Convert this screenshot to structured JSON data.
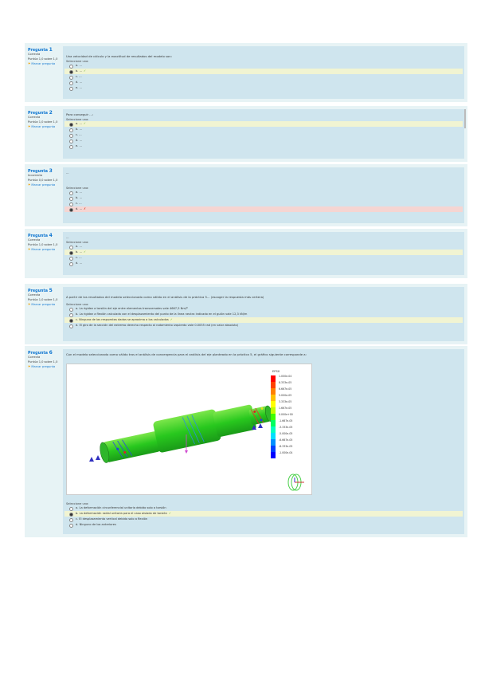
{
  "flag_label": "Marcar pregunta",
  "select_one": "Seleccione una:",
  "questions": [
    {
      "id": "1",
      "title_word": "Pregunta",
      "state": "Correcta",
      "score": "Puntúa 1,0 sobre 1,0",
      "text": "Una velocidad de cálculo y la exactitud de resultados del modelo son:",
      "options": [
        {
          "text": "a. ...",
          "status": "",
          "mark": ""
        },
        {
          "text": "b. ...",
          "status": "correct",
          "mark": "✓"
        },
        {
          "text": "c. ...",
          "status": "",
          "mark": ""
        },
        {
          "text": "d. ...",
          "status": "",
          "mark": ""
        },
        {
          "text": "e. ...",
          "status": "",
          "mark": ""
        }
      ]
    },
    {
      "id": "2",
      "title_word": "Pregunta",
      "state": "Correcta",
      "score": "Puntúa 1,0 sobre 1,0",
      "text": "Para conseguir ...:",
      "options": [
        {
          "text": "a. ...",
          "status": "correct",
          "mark": "✓"
        },
        {
          "text": "b. ...",
          "status": "",
          "mark": ""
        },
        {
          "text": "c. ...",
          "status": "",
          "mark": ""
        },
        {
          "text": "d. ...",
          "status": "",
          "mark": ""
        },
        {
          "text": "e. ...",
          "status": "",
          "mark": ""
        }
      ]
    },
    {
      "id": "3",
      "title_word": "Pregunta",
      "state": "Incorrecta",
      "score": "Puntúa 0,0 sobre 1,0",
      "text": "...",
      "options": [
        {
          "text": "a. ...",
          "status": "",
          "mark": ""
        },
        {
          "text": "b. ...",
          "status": "",
          "mark": ""
        },
        {
          "text": "c. ...",
          "status": "",
          "mark": ""
        },
        {
          "text": "d. ...",
          "status": "incorrect",
          "mark": "✗"
        }
      ]
    },
    {
      "id": "4",
      "title_word": "Pregunta",
      "state": "Correcta",
      "score": "Puntúa 1,0 sobre 1,0",
      "text": "...",
      "options": [
        {
          "text": "a. ...",
          "status": "",
          "mark": ""
        },
        {
          "text": "b. ...",
          "status": "correct",
          "mark": "✓"
        },
        {
          "text": "c. ...",
          "status": "",
          "mark": ""
        },
        {
          "text": "d. ...",
          "status": "",
          "mark": ""
        }
      ]
    },
    {
      "id": "5",
      "title_word": "Pregunta",
      "state": "Correcta",
      "score": "Puntúa 1,0 sobre 1,0",
      "text": "A partir de los resultados del modelo seleccionado como válido en el análisis de la práctica 5... (escoger la respuesta más certera)",
      "options": [
        {
          "text": "a. La rigidez a torsión del eje entre elementos transversales vale 4667,5 Nm/º",
          "status": "",
          "mark": ""
        },
        {
          "text": "b. La rigidez a flexión calculada con el desplazamiento del punto de la línea neutra indicado en el guión vale 12,3 kN/m",
          "status": "",
          "mark": ""
        },
        {
          "text": "c. Ninguna de las respuestas dadas se aproxima a los calculados",
          "status": "correct",
          "mark": "✓"
        },
        {
          "text": "d. El giro de la sección del extremo derecho respecto al rodamiento izquierdo vale 0.0055 rad (en valor absoluto)",
          "status": "",
          "mark": ""
        }
      ]
    },
    {
      "id": "6",
      "title_word": "Pregunta",
      "state": "Correcta",
      "score": "Puntúa 1,0 sobre 1,0",
      "text": "Con el modelo seleccionado como válido tras el análisis de convergencia para el análisis del eje planteado en la práctica 5, el gráfico siguiente corresponde a:",
      "figure": {
        "legend_title": "EPSX",
        "legend_values": [
          "1.000e-04",
          "8.333e-05",
          "6.667e-05",
          "5.000e-05",
          "3.333e-05",
          "1.667e-05",
          "0.000e+00",
          "-1.667e-05",
          "-3.333e-05",
          "-5.000e-05",
          "-6.667e-05",
          "-8.333e-05",
          "-1.000e-04"
        ],
        "legend_colors": [
          "#ff0000",
          "#ff4000",
          "#ff8000",
          "#ffc000",
          "#ffff00",
          "#c0ff00",
          "#40ff00",
          "#00ff60",
          "#00ffc0",
          "#00e0ff",
          "#0090ff",
          "#0040ff",
          "#0000ff"
        ]
      },
      "options": [
        {
          "text": "a. La deformación circunferencial unitaria debido solo a torsión",
          "status": "",
          "mark": ""
        },
        {
          "text": "b. La deformación radial unitaria para el caso aislado de torsión",
          "status": "correct",
          "mark": "✓"
        },
        {
          "text": "c. El desplazamiento vertical debido solo a flexión",
          "status": "",
          "mark": ""
        },
        {
          "text": "d. Ninguno de los anteriores",
          "status": "",
          "mark": ""
        }
      ]
    }
  ]
}
